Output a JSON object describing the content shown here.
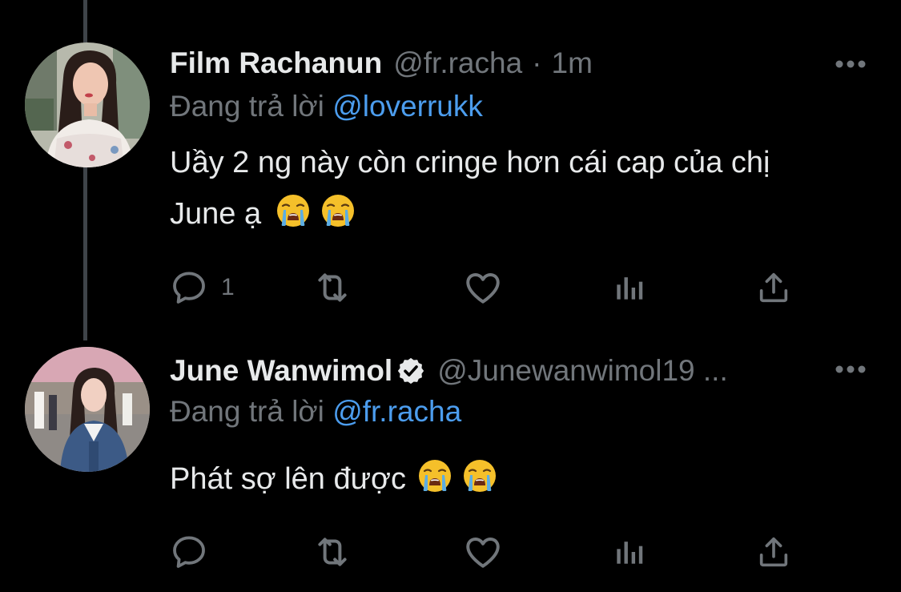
{
  "colors": {
    "background": "#000000",
    "primary_text": "#e7e9ea",
    "secondary_text": "#71767b",
    "link": "#4c9dee",
    "thread_line": "#3f4449"
  },
  "tweets": [
    {
      "display_name": "Film Rachanun",
      "handle": "@fr.racha",
      "separator": "·",
      "time": "1m",
      "verified": false,
      "replying_prefix": "Đang trả lời",
      "replying_to": "@loverrukk",
      "text_line1": "Uầy 2 ng này còn cringe hơn cái cap của chị",
      "text_line2": "June ạ",
      "emojis": [
        "loudly-crying-face",
        "loudly-crying-face"
      ],
      "reply_count": "1",
      "icons": [
        "reply-icon",
        "retweet-icon",
        "like-icon",
        "analytics-icon",
        "share-icon",
        "more-icon"
      ]
    },
    {
      "display_name": "June Wanwimol",
      "handle": "@Junewanwimol19 ...",
      "verified": true,
      "replying_prefix": "Đang trả lời",
      "replying_to": "@fr.racha",
      "text_line1": "Phát sợ lên được",
      "emojis": [
        "loudly-crying-face",
        "loudly-crying-face"
      ],
      "reply_count": "",
      "icons": [
        "reply-icon",
        "retweet-icon",
        "like-icon",
        "analytics-icon",
        "share-icon",
        "more-icon"
      ]
    }
  ]
}
